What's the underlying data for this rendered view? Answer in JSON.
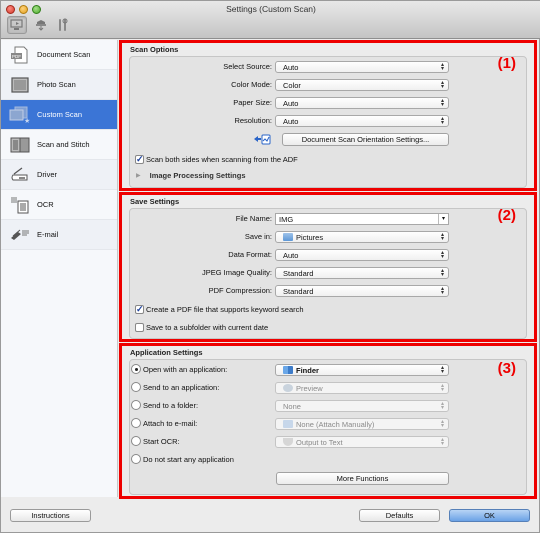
{
  "window": {
    "title": "Settings (Custom Scan)"
  },
  "toolbar": {
    "items": [
      {
        "name": "scan-from-computer-tab",
        "icon": "computer-scan-icon"
      },
      {
        "name": "scan-from-panel-tab",
        "icon": "scanner-panel-icon"
      },
      {
        "name": "general-settings-tab",
        "icon": "tools-icon"
      }
    ]
  },
  "sidebar": {
    "items": [
      {
        "label": "Document Scan",
        "icon": "document-pdf-icon"
      },
      {
        "label": "Photo Scan",
        "icon": "photo-icon"
      },
      {
        "label": "Custom Scan",
        "icon": "custom-scan-icon",
        "selected": true
      },
      {
        "label": "Scan and Stitch",
        "icon": "stitch-icon"
      },
      {
        "label": "Driver",
        "icon": "driver-scanner-icon"
      },
      {
        "label": "OCR",
        "icon": "ocr-document-icon"
      },
      {
        "label": "E-mail",
        "icon": "email-icon"
      }
    ]
  },
  "scan_options": {
    "title": "Scan Options",
    "badge": "(1)",
    "select_source": {
      "label": "Select Source:",
      "value": "Auto"
    },
    "color_mode": {
      "label": "Color Mode:",
      "value": "Color"
    },
    "paper_size": {
      "label": "Paper Size:",
      "value": "Auto"
    },
    "resolution": {
      "label": "Resolution:",
      "value": "Auto"
    },
    "orientation_button": "Document Scan Orientation Settings...",
    "scan_both_sides": {
      "label": "Scan both sides when scanning from the ADF",
      "checked": true
    },
    "image_processing": "Image Processing Settings"
  },
  "save_settings": {
    "title": "Save Settings",
    "badge": "(2)",
    "file_name": {
      "label": "File Name:",
      "value": "IMG"
    },
    "save_in": {
      "label": "Save in:",
      "value": "Pictures"
    },
    "data_format": {
      "label": "Data Format:",
      "value": "Auto"
    },
    "jpeg_quality": {
      "label": "JPEG Image Quality:",
      "value": "Standard"
    },
    "pdf_compression": {
      "label": "PDF Compression:",
      "value": "Standard"
    },
    "keyword_search": {
      "label": "Create a PDF file that supports keyword search",
      "checked": true
    },
    "subfolder_date": {
      "label": "Save to a subfolder with current date",
      "checked": false
    }
  },
  "application_settings": {
    "title": "Application Settings",
    "badge": "(3)",
    "options": [
      {
        "label": "Open with an application:",
        "value": "Finder",
        "selected": true,
        "enabled": true
      },
      {
        "label": "Send to an application:",
        "value": "Preview",
        "selected": false,
        "enabled": false
      },
      {
        "label": "Send to a folder:",
        "value": "None",
        "selected": false,
        "enabled": false
      },
      {
        "label": "Attach to e-mail:",
        "value": "None (Attach Manually)",
        "selected": false,
        "enabled": false
      },
      {
        "label": "Start OCR:",
        "value": "Output to Text",
        "selected": false,
        "enabled": false
      },
      {
        "label": "Do not start any application",
        "selected": false
      }
    ],
    "more_functions": "More Functions"
  },
  "footer": {
    "instructions": "Instructions",
    "defaults": "Defaults",
    "ok": "OK"
  },
  "colors": {
    "highlight": "#ee0000",
    "selection": "#3b75d6",
    "primary_button": "#6aa2e6"
  }
}
